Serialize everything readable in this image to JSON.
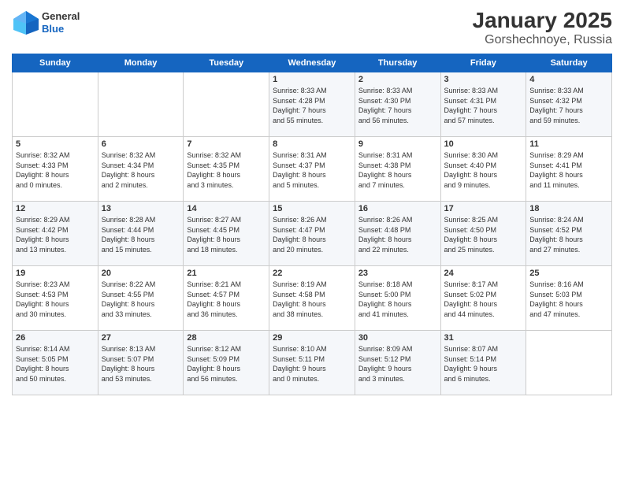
{
  "header": {
    "logo": {
      "general": "General",
      "blue": "Blue"
    },
    "title": "January 2025",
    "subtitle": "Gorshechnoye, Russia"
  },
  "weekdays": [
    "Sunday",
    "Monday",
    "Tuesday",
    "Wednesday",
    "Thursday",
    "Friday",
    "Saturday"
  ],
  "weeks": [
    [
      {
        "day": "",
        "content": ""
      },
      {
        "day": "",
        "content": ""
      },
      {
        "day": "",
        "content": ""
      },
      {
        "day": "1",
        "content": "Sunrise: 8:33 AM\nSunset: 4:28 PM\nDaylight: 7 hours\nand 55 minutes."
      },
      {
        "day": "2",
        "content": "Sunrise: 8:33 AM\nSunset: 4:30 PM\nDaylight: 7 hours\nand 56 minutes."
      },
      {
        "day": "3",
        "content": "Sunrise: 8:33 AM\nSunset: 4:31 PM\nDaylight: 7 hours\nand 57 minutes."
      },
      {
        "day": "4",
        "content": "Sunrise: 8:33 AM\nSunset: 4:32 PM\nDaylight: 7 hours\nand 59 minutes."
      }
    ],
    [
      {
        "day": "5",
        "content": "Sunrise: 8:32 AM\nSunset: 4:33 PM\nDaylight: 8 hours\nand 0 minutes."
      },
      {
        "day": "6",
        "content": "Sunrise: 8:32 AM\nSunset: 4:34 PM\nDaylight: 8 hours\nand 2 minutes."
      },
      {
        "day": "7",
        "content": "Sunrise: 8:32 AM\nSunset: 4:35 PM\nDaylight: 8 hours\nand 3 minutes."
      },
      {
        "day": "8",
        "content": "Sunrise: 8:31 AM\nSunset: 4:37 PM\nDaylight: 8 hours\nand 5 minutes."
      },
      {
        "day": "9",
        "content": "Sunrise: 8:31 AM\nSunset: 4:38 PM\nDaylight: 8 hours\nand 7 minutes."
      },
      {
        "day": "10",
        "content": "Sunrise: 8:30 AM\nSunset: 4:40 PM\nDaylight: 8 hours\nand 9 minutes."
      },
      {
        "day": "11",
        "content": "Sunrise: 8:29 AM\nSunset: 4:41 PM\nDaylight: 8 hours\nand 11 minutes."
      }
    ],
    [
      {
        "day": "12",
        "content": "Sunrise: 8:29 AM\nSunset: 4:42 PM\nDaylight: 8 hours\nand 13 minutes."
      },
      {
        "day": "13",
        "content": "Sunrise: 8:28 AM\nSunset: 4:44 PM\nDaylight: 8 hours\nand 15 minutes."
      },
      {
        "day": "14",
        "content": "Sunrise: 8:27 AM\nSunset: 4:45 PM\nDaylight: 8 hours\nand 18 minutes."
      },
      {
        "day": "15",
        "content": "Sunrise: 8:26 AM\nSunset: 4:47 PM\nDaylight: 8 hours\nand 20 minutes."
      },
      {
        "day": "16",
        "content": "Sunrise: 8:26 AM\nSunset: 4:48 PM\nDaylight: 8 hours\nand 22 minutes."
      },
      {
        "day": "17",
        "content": "Sunrise: 8:25 AM\nSunset: 4:50 PM\nDaylight: 8 hours\nand 25 minutes."
      },
      {
        "day": "18",
        "content": "Sunrise: 8:24 AM\nSunset: 4:52 PM\nDaylight: 8 hours\nand 27 minutes."
      }
    ],
    [
      {
        "day": "19",
        "content": "Sunrise: 8:23 AM\nSunset: 4:53 PM\nDaylight: 8 hours\nand 30 minutes."
      },
      {
        "day": "20",
        "content": "Sunrise: 8:22 AM\nSunset: 4:55 PM\nDaylight: 8 hours\nand 33 minutes."
      },
      {
        "day": "21",
        "content": "Sunrise: 8:21 AM\nSunset: 4:57 PM\nDaylight: 8 hours\nand 36 minutes."
      },
      {
        "day": "22",
        "content": "Sunrise: 8:19 AM\nSunset: 4:58 PM\nDaylight: 8 hours\nand 38 minutes."
      },
      {
        "day": "23",
        "content": "Sunrise: 8:18 AM\nSunset: 5:00 PM\nDaylight: 8 hours\nand 41 minutes."
      },
      {
        "day": "24",
        "content": "Sunrise: 8:17 AM\nSunset: 5:02 PM\nDaylight: 8 hours\nand 44 minutes."
      },
      {
        "day": "25",
        "content": "Sunrise: 8:16 AM\nSunset: 5:03 PM\nDaylight: 8 hours\nand 47 minutes."
      }
    ],
    [
      {
        "day": "26",
        "content": "Sunrise: 8:14 AM\nSunset: 5:05 PM\nDaylight: 8 hours\nand 50 minutes."
      },
      {
        "day": "27",
        "content": "Sunrise: 8:13 AM\nSunset: 5:07 PM\nDaylight: 8 hours\nand 53 minutes."
      },
      {
        "day": "28",
        "content": "Sunrise: 8:12 AM\nSunset: 5:09 PM\nDaylight: 8 hours\nand 56 minutes."
      },
      {
        "day": "29",
        "content": "Sunrise: 8:10 AM\nSunset: 5:11 PM\nDaylight: 9 hours\nand 0 minutes."
      },
      {
        "day": "30",
        "content": "Sunrise: 8:09 AM\nSunset: 5:12 PM\nDaylight: 9 hours\nand 3 minutes."
      },
      {
        "day": "31",
        "content": "Sunrise: 8:07 AM\nSunset: 5:14 PM\nDaylight: 9 hours\nand 6 minutes."
      },
      {
        "day": "",
        "content": ""
      }
    ]
  ]
}
